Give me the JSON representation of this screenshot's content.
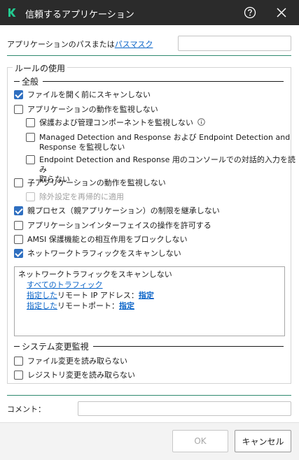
{
  "window": {
    "title": "信頼するアプリケーション"
  },
  "app_path": {
    "label_prefix": "アプリケーションのパスまたは",
    "link": "パスマスク",
    "value": ""
  },
  "rules": {
    "legend": "ルールの使用",
    "general_title": "全般",
    "items": [
      {
        "label": "ファイルを開く前にスキャンしない",
        "checked": true
      },
      {
        "label": "アプリケーションの動作を監視しない",
        "checked": false
      },
      {
        "label": "保護および管理コンポーネントを監視しない",
        "checked": false
      },
      {
        "label1": "Managed Detection and Response および Endpoint Detection and",
        "label2": "Response を監視しない",
        "checked": false
      },
      {
        "label1": "Endpoint Detection and Response 用のコンソールでの対話的入力を読み",
        "label2": "取らない",
        "checked": false
      },
      {
        "label": "子アプリケーションの動作を監視しない",
        "checked": false
      },
      {
        "label": "除外設定を再帰的に適用",
        "checked": false,
        "disabled": true
      },
      {
        "label": "親プロセス（親アプリケーション）の制限を継承しない",
        "checked": true
      },
      {
        "label": "アプリケーションインターフェイスの操作を許可する",
        "checked": false
      },
      {
        "label": "AMSI 保護機能との相互作用をブロックしない",
        "checked": false
      },
      {
        "label": "ネットワークトラフィックをスキャンしない",
        "checked": true
      }
    ],
    "traffic": {
      "heading": "ネットワークトラフィックをスキャンしない",
      "all_traffic": "すべてのトラフィック",
      "ip_link": "指定した",
      "ip_text": "リモート IP アドレス：",
      "ip_value": "指定",
      "port_link": "指定した",
      "port_text": "リモートポート：",
      "port_value": "指定"
    },
    "system_title": "システム変更監視",
    "system_items": [
      {
        "label": "ファイル変更を読み取らない",
        "checked": false
      },
      {
        "label": "レジストリ変更を読み取らない",
        "checked": false
      }
    ]
  },
  "comment": {
    "label": "コメント：",
    "value": ""
  },
  "buttons": {
    "ok": "OK",
    "cancel": "キャンセル"
  },
  "colors": {
    "titlebar": "#2b2b2b",
    "accent": "#2f8a6f",
    "checkbox": "#2f6fc0",
    "link": "#0a64c8"
  }
}
